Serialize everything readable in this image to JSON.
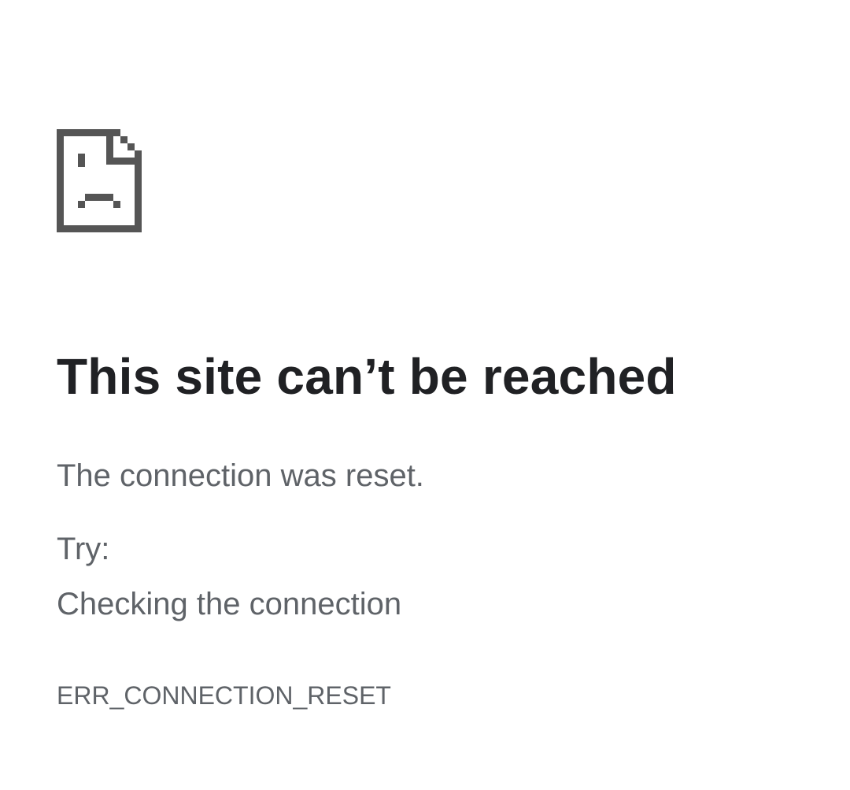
{
  "error_page": {
    "icon": "sad-document-icon",
    "title": "This site can’t be reached",
    "message": "The connection was reset.",
    "try_label": "Try:",
    "suggestion": "Checking the connection",
    "error_code": "ERR_CONNECTION_RESET"
  },
  "colors": {
    "title": "#202124",
    "body_text": "#5f6368",
    "icon": "#555555",
    "background": "#ffffff"
  }
}
